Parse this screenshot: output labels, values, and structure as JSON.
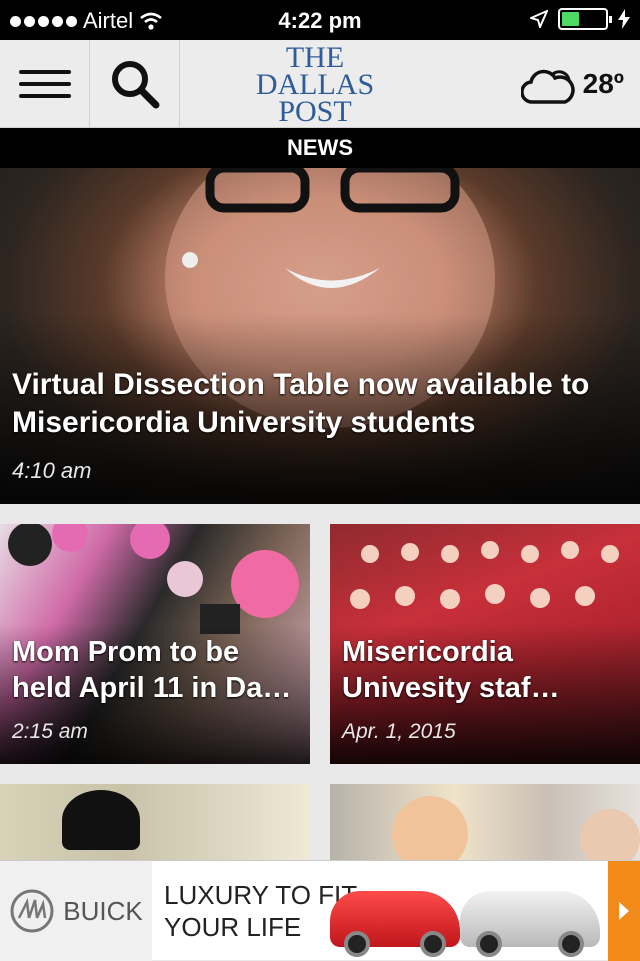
{
  "status_bar": {
    "carrier": "Airtel",
    "time": "4:22 pm"
  },
  "header": {
    "logo_line1": "THE",
    "logo_line2": "DALLAS",
    "logo_line3": "POST",
    "temperature": "28º",
    "icons": {
      "menu": "menu-icon",
      "search": "search-icon",
      "weather": "cloud-sun-icon"
    }
  },
  "section": {
    "title": "NEWS"
  },
  "hero": {
    "title": "Virtual Dissection Table now available to Misericordia University students",
    "time": "4:10 am"
  },
  "cards": [
    {
      "title": "Mom Prom to be held April 11 in Da…",
      "time": "2:15 am"
    },
    {
      "title": "Misericordia Univesity staf…",
      "time": "Apr. 1, 2015"
    }
  ],
  "ad": {
    "brand": "BUICK",
    "tagline_line1": "LUXURY TO FIT",
    "tagline_line2": "YOUR LIFE"
  },
  "colors": {
    "logo": "#2f5d9c",
    "battery": "#4cd964",
    "ad_cta": "#f28a1a"
  }
}
